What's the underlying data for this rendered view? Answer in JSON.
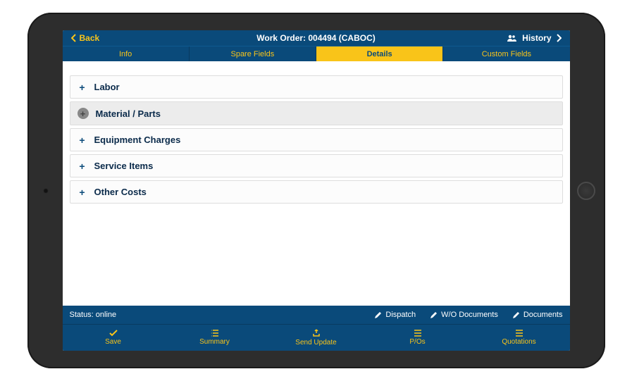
{
  "header": {
    "back_label": "Back",
    "title": "Work Order: 004494   (CABOC)",
    "history_label": "History"
  },
  "tabs": [
    {
      "label": "Info",
      "active": false
    },
    {
      "label": "Spare Fields",
      "active": false
    },
    {
      "label": "Details",
      "active": true
    },
    {
      "label": "Custom Fields",
      "active": false
    }
  ],
  "sections": [
    {
      "label": "Labor",
      "highlight": false,
      "circle": false
    },
    {
      "label": "Material / Parts",
      "highlight": true,
      "circle": true
    },
    {
      "label": "Equipment Charges",
      "highlight": false,
      "circle": false
    },
    {
      "label": "Service Items",
      "highlight": false,
      "circle": false
    },
    {
      "label": "Other Costs",
      "highlight": false,
      "circle": false
    }
  ],
  "status": {
    "text": "Status: online",
    "links": [
      {
        "label": "Dispatch",
        "icon": "pencil"
      },
      {
        "label": "W/O Documents",
        "icon": "pencil"
      },
      {
        "label": "Documents",
        "icon": "pencil"
      }
    ]
  },
  "bottom": [
    {
      "label": "Save",
      "icon": "check"
    },
    {
      "label": "Summary",
      "icon": "list"
    },
    {
      "label": "Send Update",
      "icon": "share"
    },
    {
      "label": "P/Os",
      "icon": "lines"
    },
    {
      "label": "Quotations",
      "icon": "lines"
    }
  ]
}
